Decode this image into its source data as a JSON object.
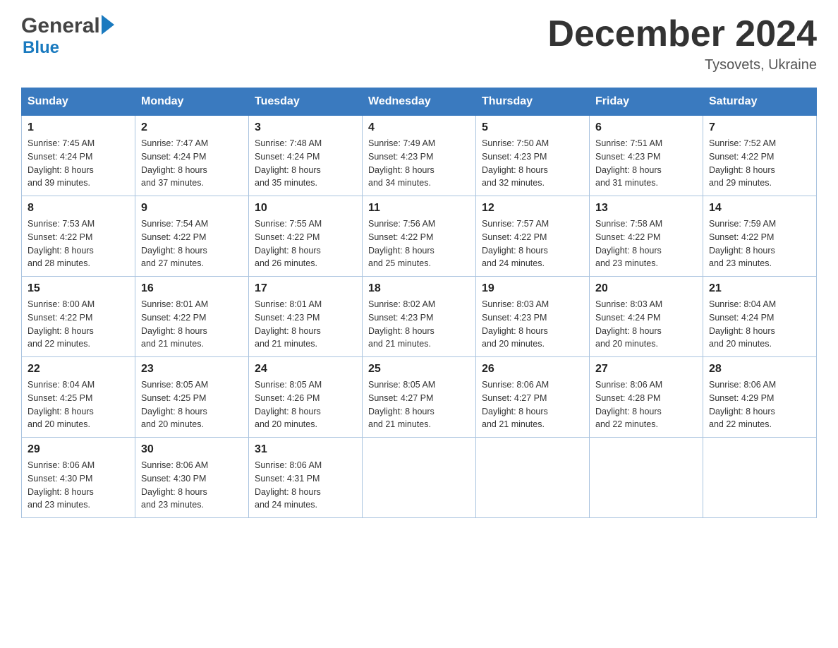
{
  "header": {
    "logo_general": "General",
    "logo_blue": "Blue",
    "month_title": "December 2024",
    "location": "Tysovets, Ukraine"
  },
  "days_of_week": [
    "Sunday",
    "Monday",
    "Tuesday",
    "Wednesday",
    "Thursday",
    "Friday",
    "Saturday"
  ],
  "weeks": [
    [
      {
        "day": "1",
        "sunrise": "7:45 AM",
        "sunset": "4:24 PM",
        "daylight": "8 hours and 39 minutes."
      },
      {
        "day": "2",
        "sunrise": "7:47 AM",
        "sunset": "4:24 PM",
        "daylight": "8 hours and 37 minutes."
      },
      {
        "day": "3",
        "sunrise": "7:48 AM",
        "sunset": "4:24 PM",
        "daylight": "8 hours and 35 minutes."
      },
      {
        "day": "4",
        "sunrise": "7:49 AM",
        "sunset": "4:23 PM",
        "daylight": "8 hours and 34 minutes."
      },
      {
        "day": "5",
        "sunrise": "7:50 AM",
        "sunset": "4:23 PM",
        "daylight": "8 hours and 32 minutes."
      },
      {
        "day": "6",
        "sunrise": "7:51 AM",
        "sunset": "4:23 PM",
        "daylight": "8 hours and 31 minutes."
      },
      {
        "day": "7",
        "sunrise": "7:52 AM",
        "sunset": "4:22 PM",
        "daylight": "8 hours and 29 minutes."
      }
    ],
    [
      {
        "day": "8",
        "sunrise": "7:53 AM",
        "sunset": "4:22 PM",
        "daylight": "8 hours and 28 minutes."
      },
      {
        "day": "9",
        "sunrise": "7:54 AM",
        "sunset": "4:22 PM",
        "daylight": "8 hours and 27 minutes."
      },
      {
        "day": "10",
        "sunrise": "7:55 AM",
        "sunset": "4:22 PM",
        "daylight": "8 hours and 26 minutes."
      },
      {
        "day": "11",
        "sunrise": "7:56 AM",
        "sunset": "4:22 PM",
        "daylight": "8 hours and 25 minutes."
      },
      {
        "day": "12",
        "sunrise": "7:57 AM",
        "sunset": "4:22 PM",
        "daylight": "8 hours and 24 minutes."
      },
      {
        "day": "13",
        "sunrise": "7:58 AM",
        "sunset": "4:22 PM",
        "daylight": "8 hours and 23 minutes."
      },
      {
        "day": "14",
        "sunrise": "7:59 AM",
        "sunset": "4:22 PM",
        "daylight": "8 hours and 23 minutes."
      }
    ],
    [
      {
        "day": "15",
        "sunrise": "8:00 AM",
        "sunset": "4:22 PM",
        "daylight": "8 hours and 22 minutes."
      },
      {
        "day": "16",
        "sunrise": "8:01 AM",
        "sunset": "4:22 PM",
        "daylight": "8 hours and 21 minutes."
      },
      {
        "day": "17",
        "sunrise": "8:01 AM",
        "sunset": "4:23 PM",
        "daylight": "8 hours and 21 minutes."
      },
      {
        "day": "18",
        "sunrise": "8:02 AM",
        "sunset": "4:23 PM",
        "daylight": "8 hours and 21 minutes."
      },
      {
        "day": "19",
        "sunrise": "8:03 AM",
        "sunset": "4:23 PM",
        "daylight": "8 hours and 20 minutes."
      },
      {
        "day": "20",
        "sunrise": "8:03 AM",
        "sunset": "4:24 PM",
        "daylight": "8 hours and 20 minutes."
      },
      {
        "day": "21",
        "sunrise": "8:04 AM",
        "sunset": "4:24 PM",
        "daylight": "8 hours and 20 minutes."
      }
    ],
    [
      {
        "day": "22",
        "sunrise": "8:04 AM",
        "sunset": "4:25 PM",
        "daylight": "8 hours and 20 minutes."
      },
      {
        "day": "23",
        "sunrise": "8:05 AM",
        "sunset": "4:25 PM",
        "daylight": "8 hours and 20 minutes."
      },
      {
        "day": "24",
        "sunrise": "8:05 AM",
        "sunset": "4:26 PM",
        "daylight": "8 hours and 20 minutes."
      },
      {
        "day": "25",
        "sunrise": "8:05 AM",
        "sunset": "4:27 PM",
        "daylight": "8 hours and 21 minutes."
      },
      {
        "day": "26",
        "sunrise": "8:06 AM",
        "sunset": "4:27 PM",
        "daylight": "8 hours and 21 minutes."
      },
      {
        "day": "27",
        "sunrise": "8:06 AM",
        "sunset": "4:28 PM",
        "daylight": "8 hours and 22 minutes."
      },
      {
        "day": "28",
        "sunrise": "8:06 AM",
        "sunset": "4:29 PM",
        "daylight": "8 hours and 22 minutes."
      }
    ],
    [
      {
        "day": "29",
        "sunrise": "8:06 AM",
        "sunset": "4:30 PM",
        "daylight": "8 hours and 23 minutes."
      },
      {
        "day": "30",
        "sunrise": "8:06 AM",
        "sunset": "4:30 PM",
        "daylight": "8 hours and 23 minutes."
      },
      {
        "day": "31",
        "sunrise": "8:06 AM",
        "sunset": "4:31 PM",
        "daylight": "8 hours and 24 minutes."
      },
      null,
      null,
      null,
      null
    ]
  ],
  "labels": {
    "sunrise": "Sunrise:",
    "sunset": "Sunset:",
    "daylight": "Daylight:"
  }
}
